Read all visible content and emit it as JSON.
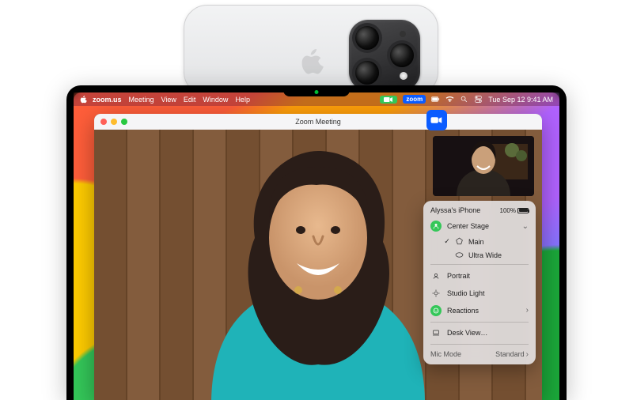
{
  "menubar": {
    "app": "zoom.us",
    "items": [
      "Meeting",
      "View",
      "Edit",
      "Window",
      "Help"
    ],
    "cc_label": "zoom.us",
    "clock": "Tue Sep 12  9:41 AM",
    "zoom_badge": "zoom"
  },
  "window": {
    "title": "Zoom Meeting"
  },
  "cc": {
    "device": "Alyssa's iPhone",
    "battery": "100%",
    "center_stage": "Center Stage",
    "lens_main": "Main",
    "lens_uw": "Ultra Wide",
    "portrait": "Portrait",
    "studio_light": "Studio Light",
    "reactions": "Reactions",
    "desk_view": "Desk View…",
    "mic_mode": "Mic Mode",
    "mic_value": "Standard"
  }
}
